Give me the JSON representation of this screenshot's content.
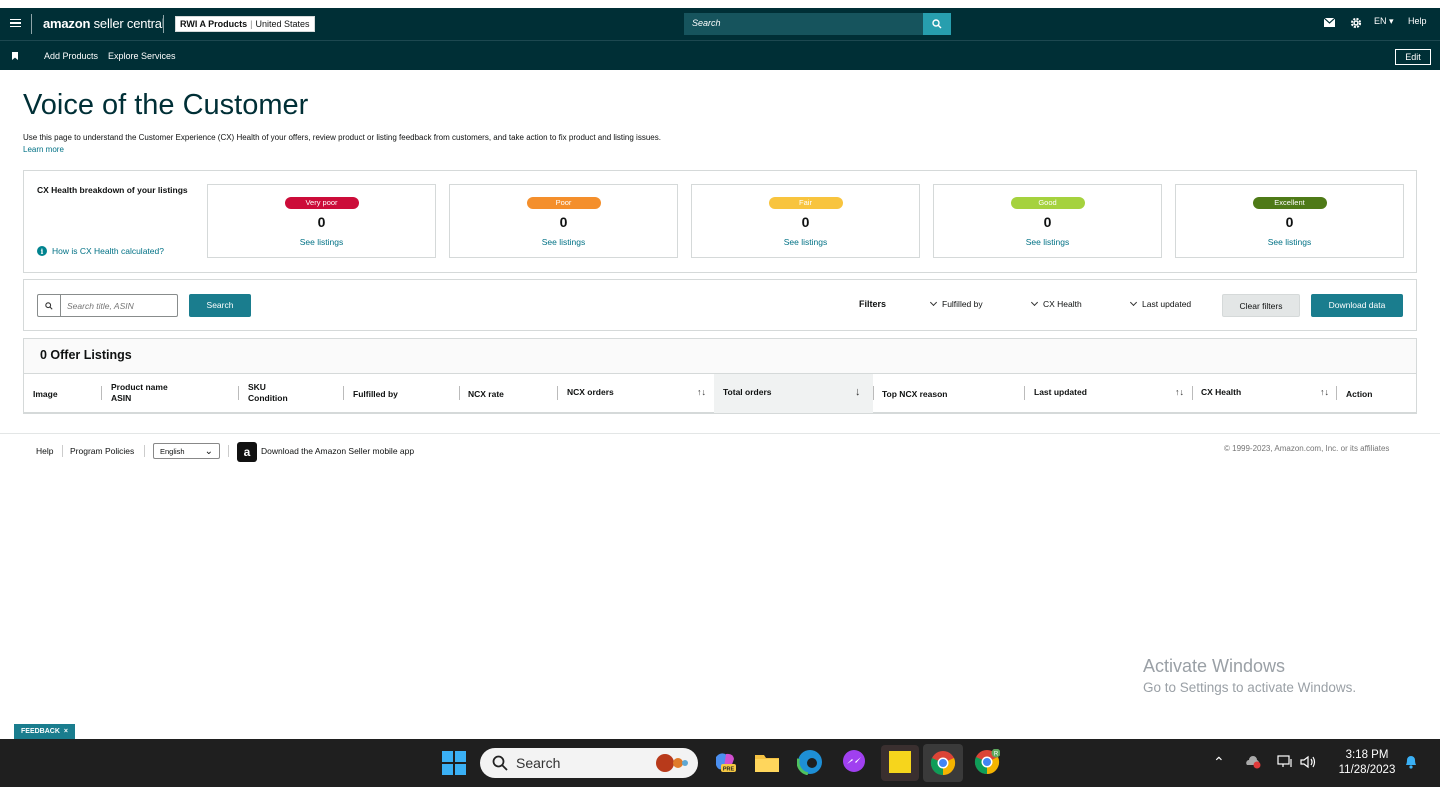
{
  "topbar": {
    "logo_prefix": "amazon",
    "logo_suffix": " seller central",
    "store_name": "RWI A Products",
    "store_region": "United States",
    "search_placeholder": "Search",
    "language": "EN",
    "help": "Help"
  },
  "nav": {
    "add_products": "Add Products",
    "explore_services": "Explore Services",
    "edit": "Edit"
  },
  "page": {
    "title": "Voice of the Customer",
    "description": "Use this page to understand the Customer Experience (CX) Health of your offers, review product or listing feedback from customers, and take action to fix product and listing issues.",
    "learn_more": "Learn more"
  },
  "cx": {
    "label": "CX Health breakdown of your listings",
    "calc_link": "How is CX Health calculated?",
    "info_glyph": "i",
    "cards": [
      {
        "label": "Very poor",
        "count": "0",
        "link": "See listings",
        "color": "#cc0c39"
      },
      {
        "label": "Poor",
        "count": "0",
        "link": "See listings",
        "color": "#f48f2c"
      },
      {
        "label": "Fair",
        "count": "0",
        "link": "See listings",
        "color": "#f8c43e"
      },
      {
        "label": "Good",
        "count": "0",
        "link": "See listings",
        "color": "#a5d23e"
      },
      {
        "label": "Excellent",
        "count": "0",
        "link": "See listings",
        "color": "#4e7a17"
      }
    ]
  },
  "filters": {
    "search_placeholder": "Search title, ASIN",
    "search_btn": "Search",
    "label": "Filters",
    "fulfilled_by": "Fulfilled by",
    "cx_health": "CX Health",
    "last_updated": "Last updated",
    "clear": "Clear filters",
    "download": "Download data"
  },
  "table": {
    "title": "0 Offer Listings",
    "columns": {
      "image": "Image",
      "product_name": "Product name",
      "asin": "ASIN",
      "sku": "SKU",
      "condition": "Condition",
      "fulfilled_by": "Fulfilled by",
      "ncx_rate": "NCX rate",
      "ncx_orders": "NCX orders",
      "total_orders": "Total orders",
      "top_ncx_reason": "Top NCX reason",
      "last_updated": "Last updated",
      "cx_health": "CX Health",
      "action": "Action"
    },
    "sorted_column": "Total orders",
    "sort_direction": "descending"
  },
  "footer": {
    "help": "Help",
    "program_policies": "Program Policies",
    "language": "English",
    "app_glyph": "a",
    "app_link": "Download the Amazon Seller mobile app",
    "copyright": "© 1999-2023, Amazon.com, Inc. or its affiliates"
  },
  "watermark": {
    "line1": "Activate Windows",
    "line2": "Go to Settings to activate Windows."
  },
  "feedback": {
    "label": "FEEDBACK",
    "close": "×"
  },
  "taskbar": {
    "search": "Search",
    "time": "3:18 PM",
    "date": "11/28/2023",
    "copilot_badge": "PRE",
    "chrome_profile_badge": "R"
  },
  "colors": {
    "header_bg": "#002f36",
    "accent": "#1a7d8e",
    "link": "#007185"
  }
}
